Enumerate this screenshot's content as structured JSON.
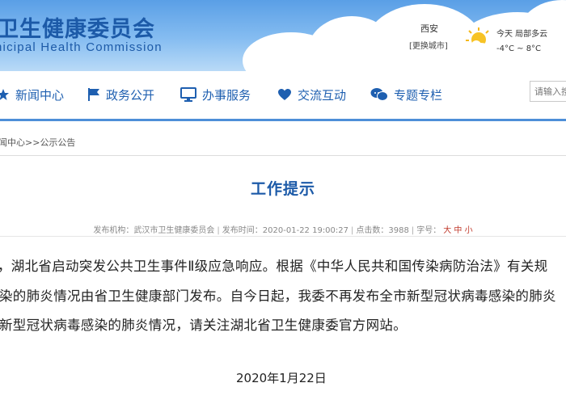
{
  "header": {
    "brand_cn": "卫生健康委员会",
    "brand_en": "nicipal Health Commission",
    "weather": {
      "city": "西安",
      "switch_city": "[更换城市]",
      "today": "今天 局部多云",
      "temp": "-4°C ~ 8°C",
      "icon": "partly-cloudy-sun-icon"
    }
  },
  "nav": {
    "items": [
      {
        "label": "新闻中心",
        "icon": "star-icon"
      },
      {
        "label": "政务公开",
        "icon": "flag-icon"
      },
      {
        "label": "办事服务",
        "icon": "monitor-icon"
      },
      {
        "label": "交流互动",
        "icon": "heart-icon"
      },
      {
        "label": "专题专栏",
        "icon": "chat-icon"
      }
    ],
    "search_placeholder": "请输入搜"
  },
  "breadcrumb": {
    "first": "闻中心",
    "sep": ">>",
    "second": "公示公告"
  },
  "article": {
    "title": "工作提示",
    "meta": {
      "source_label": "发布机构：",
      "source": "武汉市卫生健康委员会",
      "sep": "|",
      "time_label": "发布时间：",
      "time": "2020-01-22 19:00:27",
      "clicks_label": "点击数：",
      "clicks": "3988",
      "font_label": "字号：",
      "font_sizes": "大 中 小"
    },
    "lines": [
      "，湖北省启动突发公共卫生事件Ⅱ级应急响应。根据《中华人民共和国传染病防治法》有关规",
      "染的肺炎情况由省卫生健康部门发布。自今日起，我委不再发布全市新型冠状病毒感染的肺炎",
      "新型冠状病毒感染的肺炎情况，请关注湖北省卫生健康委官方网站。"
    ],
    "date": "2020年1月22日"
  },
  "colors": {
    "brand_blue": "#1c5aa8",
    "nav_blue": "#1e5fb0",
    "rule_blue": "#4d8fd8",
    "font_size_red": "#c0392b"
  }
}
